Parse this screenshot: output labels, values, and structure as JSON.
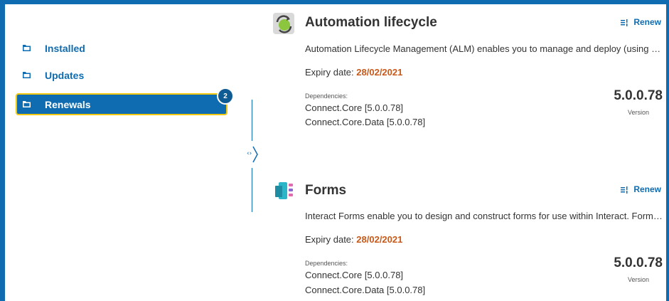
{
  "sidebar": {
    "items": [
      {
        "label": "Installed"
      },
      {
        "label": "Updates"
      },
      {
        "label": "Renewals"
      }
    ],
    "badge": "2"
  },
  "toggle": {
    "icon": "code-arrows-icon"
  },
  "cards": [
    {
      "icon": "automation-lifecycle-icon",
      "title": "Automation lifecycle",
      "renew_label": "Renew",
      "description": "Automation Lifecycle Management (ALM) enables you to manage and deploy (using an automated process)",
      "expiry_prefix": "Expiry date:",
      "expiry_date": "28/02/2021",
      "dependencies_label": "Dependencies:",
      "dependencies": [
        "Connect.Core [5.0.0.78]",
        "Connect.Core.Data [5.0.0.78]"
      ],
      "version": "5.0.0.78",
      "version_label": "Version"
    },
    {
      "icon": "forms-icon",
      "title": "Forms",
      "renew_label": "Renew",
      "description": "Interact Forms enable you to design and construct forms for use within Interact. Forms can be used",
      "expiry_prefix": "Expiry date:",
      "expiry_date": "28/02/2021",
      "dependencies_label": "Dependencies:",
      "dependencies": [
        "Connect.Core [5.0.0.78]",
        "Connect.Core.Data [5.0.0.78]"
      ],
      "version": "5.0.0.78",
      "version_label": "Version"
    }
  ],
  "colors": {
    "accent": "#0f6cb0",
    "highlight": "#f2c811",
    "expiry": "#c8591a"
  }
}
